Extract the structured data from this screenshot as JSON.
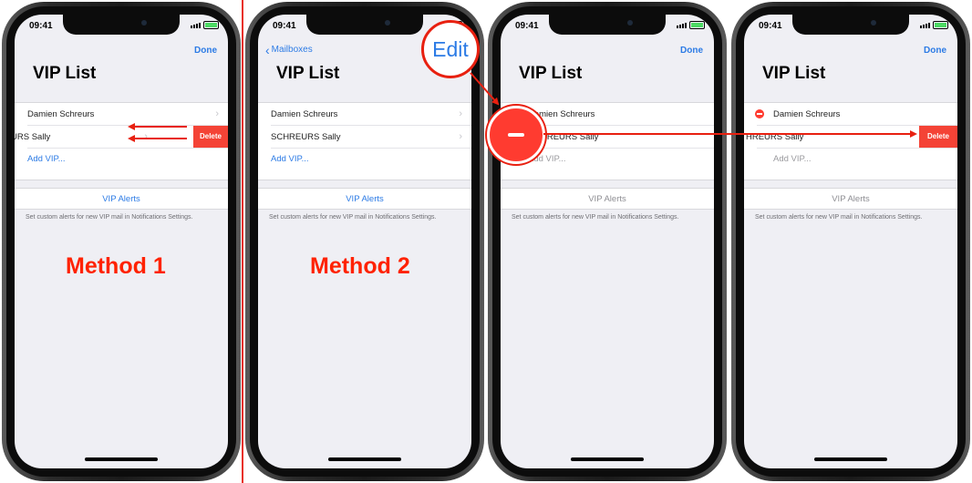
{
  "status": {
    "time": "09:41"
  },
  "nav": {
    "done": "Done",
    "back": "Mailboxes",
    "edit": "Edit"
  },
  "title": "VIP List",
  "contacts": {
    "first": "Damien Schreurs",
    "second_full": "SCHREURS Sally",
    "second_shifted": "URS Sally",
    "second_edit": "HREURS Sally",
    "second_swiped": "HREURS Sally"
  },
  "add_vip": "Add VIP...",
  "vip_alerts": "VIP Alerts",
  "note": "Set custom alerts for new VIP mail in Notifications Settings.",
  "delete": "Delete",
  "labels": {
    "method1": "Method 1",
    "method2": "Method 2"
  },
  "colors": {
    "accent": "#2c7be5",
    "annotation": "#e82010",
    "delete": "#f44336"
  }
}
